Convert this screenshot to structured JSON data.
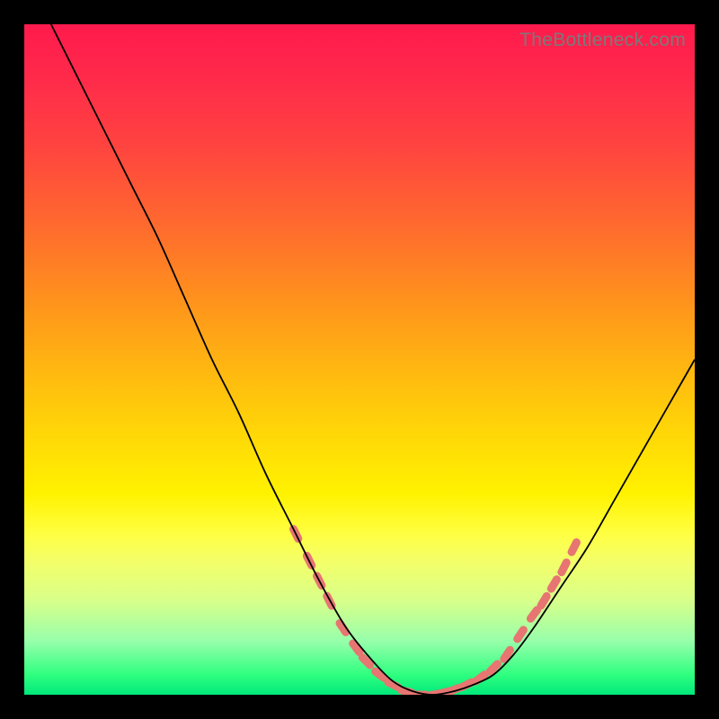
{
  "watermark": "TheBottleneck.com",
  "chart_data": {
    "type": "line",
    "title": "",
    "xlabel": "",
    "ylabel": "",
    "xlim": [
      0,
      100
    ],
    "ylim": [
      0,
      100
    ],
    "series": [
      {
        "name": "bottleneck-curve",
        "x": [
          4,
          8,
          12,
          16,
          20,
          24,
          28,
          32,
          36,
          40,
          44,
          48,
          52,
          55,
          58,
          61,
          64,
          67,
          70,
          73,
          76,
          80,
          84,
          88,
          92,
          96,
          100
        ],
        "y": [
          100,
          92,
          84,
          76,
          68,
          59,
          50,
          42,
          33,
          25,
          17,
          10,
          5,
          2,
          0.5,
          0,
          0.5,
          1.5,
          3,
          6,
          10,
          16,
          22,
          29,
          36,
          43,
          50
        ]
      }
    ],
    "markers": {
      "name": "highlight-dashes",
      "description": "salmon dashed segments along the curve near the valley",
      "points": [
        {
          "x": 40.5,
          "y": 24
        },
        {
          "x": 42.5,
          "y": 20
        },
        {
          "x": 44,
          "y": 17
        },
        {
          "x": 45.5,
          "y": 14
        },
        {
          "x": 47.5,
          "y": 10
        },
        {
          "x": 49.5,
          "y": 7
        },
        {
          "x": 51,
          "y": 5
        },
        {
          "x": 53,
          "y": 3
        },
        {
          "x": 55,
          "y": 1.5
        },
        {
          "x": 57,
          "y": 0.5
        },
        {
          "x": 59,
          "y": 0
        },
        {
          "x": 61,
          "y": 0
        },
        {
          "x": 62.5,
          "y": 0.3
        },
        {
          "x": 64,
          "y": 0.7
        },
        {
          "x": 66,
          "y": 1.5
        },
        {
          "x": 68,
          "y": 2.5
        },
        {
          "x": 70,
          "y": 4
        },
        {
          "x": 72,
          "y": 6
        },
        {
          "x": 74,
          "y": 9
        },
        {
          "x": 76,
          "y": 12
        },
        {
          "x": 77.5,
          "y": 14
        },
        {
          "x": 79,
          "y": 16.5
        },
        {
          "x": 80.5,
          "y": 19
        },
        {
          "x": 82,
          "y": 22
        }
      ]
    },
    "background": {
      "type": "vertical-gradient",
      "stops": [
        {
          "pos": 0,
          "color": "#ff1a4d"
        },
        {
          "pos": 50,
          "color": "#ffb212"
        },
        {
          "pos": 75,
          "color": "#fff200"
        },
        {
          "pos": 100,
          "color": "#00e87a"
        }
      ]
    }
  }
}
